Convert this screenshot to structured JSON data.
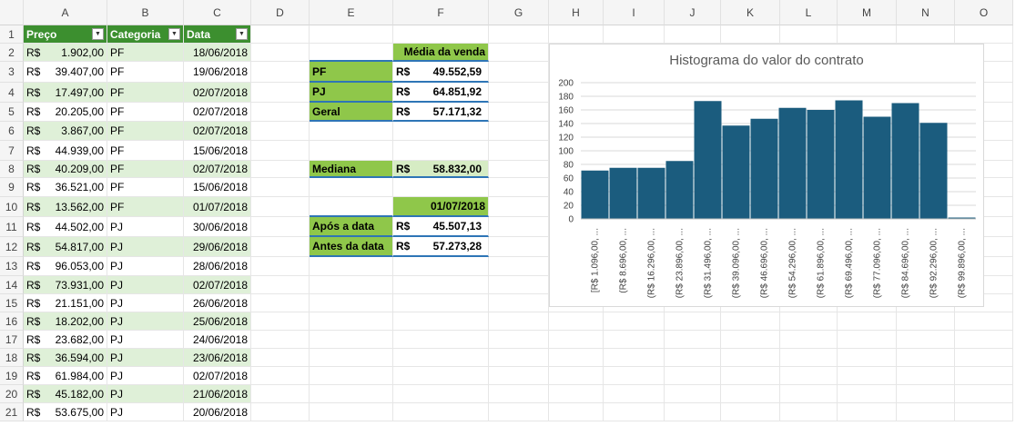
{
  "columns": [
    "A",
    "B",
    "C",
    "D",
    "E",
    "F",
    "G",
    "H",
    "I",
    "J",
    "K",
    "L",
    "M",
    "N",
    "O"
  ],
  "rows": [
    "1",
    "2",
    "3",
    "4",
    "5",
    "6",
    "7",
    "8",
    "9",
    "10",
    "11",
    "12",
    "13",
    "14",
    "15",
    "16",
    "17",
    "18",
    "19",
    "20",
    "21"
  ],
  "table": {
    "headers": [
      "Preço",
      "Categoria",
      "Data"
    ],
    "currency": "R$",
    "records": [
      {
        "price": "1.902,00",
        "cat": "PF",
        "date": "18/06/2018"
      },
      {
        "price": "39.407,00",
        "cat": "PF",
        "date": "19/06/2018"
      },
      {
        "price": "17.497,00",
        "cat": "PF",
        "date": "02/07/2018"
      },
      {
        "price": "20.205,00",
        "cat": "PF",
        "date": "02/07/2018"
      },
      {
        "price": "3.867,00",
        "cat": "PF",
        "date": "02/07/2018"
      },
      {
        "price": "44.939,00",
        "cat": "PF",
        "date": "15/06/2018"
      },
      {
        "price": "40.209,00",
        "cat": "PF",
        "date": "02/07/2018"
      },
      {
        "price": "36.521,00",
        "cat": "PF",
        "date": "15/06/2018"
      },
      {
        "price": "13.562,00",
        "cat": "PF",
        "date": "01/07/2018"
      },
      {
        "price": "44.502,00",
        "cat": "PJ",
        "date": "30/06/2018"
      },
      {
        "price": "54.817,00",
        "cat": "PJ",
        "date": "29/06/2018"
      },
      {
        "price": "96.053,00",
        "cat": "PJ",
        "date": "28/06/2018"
      },
      {
        "price": "73.931,00",
        "cat": "PJ",
        "date": "02/07/2018"
      },
      {
        "price": "21.151,00",
        "cat": "PJ",
        "date": "26/06/2018"
      },
      {
        "price": "18.202,00",
        "cat": "PJ",
        "date": "25/06/2018"
      },
      {
        "price": "23.682,00",
        "cat": "PJ",
        "date": "24/06/2018"
      },
      {
        "price": "36.594,00",
        "cat": "PJ",
        "date": "23/06/2018"
      },
      {
        "price": "61.984,00",
        "cat": "PJ",
        "date": "02/07/2018"
      },
      {
        "price": "45.182,00",
        "cat": "PJ",
        "date": "21/06/2018"
      },
      {
        "price": "53.675,00",
        "cat": "PJ",
        "date": "20/06/2018"
      }
    ]
  },
  "summary": {
    "media_header": "Média da venda",
    "pf_label": "PF",
    "pf_value": "49.552,59",
    "pj_label": "PJ",
    "pj_value": "64.851,92",
    "geral_label": "Geral",
    "geral_value": "57.171,32",
    "mediana_label": "Mediana",
    "mediana_value": "58.832,00",
    "date_value": "01/07/2018",
    "apos_label": "Após a data",
    "apos_value": "45.507,13",
    "antes_label": "Antes da data",
    "antes_value": "57.273,28"
  },
  "chart_data": {
    "type": "bar",
    "title": "Histograma do valor do contrato",
    "categories": [
      "[R$ 1.096,00, ...",
      "(R$ 8.696,00, ...",
      "(R$ 16.296,00, ...",
      "(R$ 23.896,00, ...",
      "(R$ 31.496,00, ...",
      "(R$ 39.096,00, ...",
      "(R$ 46.696,00, ...",
      "(R$ 54.296,00, ...",
      "(R$ 61.896,00, ...",
      "(R$ 69.496,00, ...",
      "(R$ 77.096,00, ...",
      "(R$ 84.696,00, ...",
      "(R$ 92.296,00, ...",
      "(R$ 99.896,00, ..."
    ],
    "values": [
      71,
      75,
      75,
      85,
      173,
      137,
      147,
      163,
      160,
      174,
      150,
      170,
      141,
      2
    ],
    "ylim": [
      0,
      200
    ],
    "yticks": [
      "0",
      "20",
      "40",
      "60",
      "80",
      "100",
      "120",
      "140",
      "160",
      "180",
      "200"
    ],
    "bar_color": "#1b5c7e",
    "grid": true
  }
}
